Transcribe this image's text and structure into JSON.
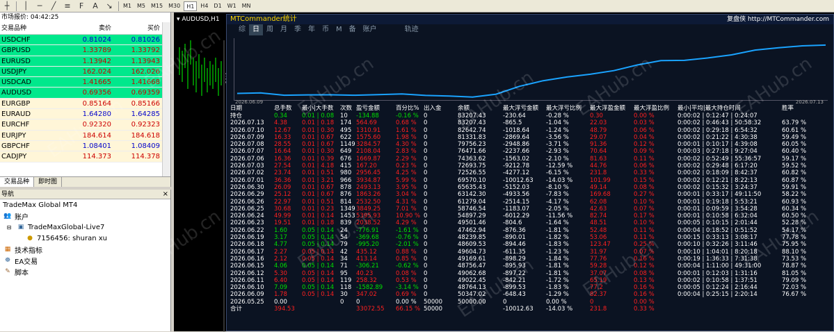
{
  "toolbar": {
    "timeframes": [
      "M1",
      "M5",
      "M15",
      "M30",
      "H1",
      "H4",
      "D1",
      "W1",
      "MN"
    ],
    "active": "H1"
  },
  "market_watch": {
    "title": "市场报价: 04:42:25",
    "col_symbol": "交易品种",
    "col_bid": "卖价",
    "col_ask": "买价",
    "rows": [
      {
        "sym": "USDCHF",
        "bid": "0.81024",
        "ask": "0.81026",
        "bg": "#00e88c",
        "color": "#0000cc"
      },
      {
        "sym": "GBPUSD",
        "bid": "1.33789",
        "ask": "1.33792",
        "bg": "#00e88c",
        "color": "#cc0000"
      },
      {
        "sym": "EURUSD",
        "bid": "1.13942",
        "ask": "1.13943",
        "bg": "#00e88c",
        "color": "#cc0000"
      },
      {
        "sym": "USDJPY",
        "bid": "162.024",
        "ask": "162.026",
        "bg": "#00e88c",
        "color": "#cc0000"
      },
      {
        "sym": "USDCAD",
        "bid": "1.41665",
        "ask": "1.41668",
        "bg": "#00e88c",
        "color": "#cc0000"
      },
      {
        "sym": "AUDUSD",
        "bid": "0.69356",
        "ask": "0.69359",
        "bg": "#00e88c",
        "color": "#cc0000"
      },
      {
        "sym": "EURGBP",
        "bid": "0.85164",
        "ask": "0.85166",
        "bg": "#fff6d8",
        "color": "#cc0000"
      },
      {
        "sym": "EURAUD",
        "bid": "1.64280",
        "ask": "1.64285",
        "bg": "#fff6d8",
        "color": "#0000cc"
      },
      {
        "sym": "EURCHF",
        "bid": "0.92320",
        "ask": "0.92323",
        "bg": "#fff6d8",
        "color": "#cc0000"
      },
      {
        "sym": "EURJPY",
        "bid": "184.614",
        "ask": "184.618",
        "bg": "#fff6d8",
        "color": "#cc0000"
      },
      {
        "sym": "GBPCHF",
        "bid": "1.08401",
        "ask": "1.08409",
        "bg": "#fff6d8",
        "color": "#0000cc"
      },
      {
        "sym": "CADJPY",
        "bid": "114.373",
        "ask": "114.378",
        "bg": "#fff6d8",
        "color": "#cc0000"
      }
    ],
    "tab_symbols": "交易品种",
    "tab_ticks": "即时图"
  },
  "navigator": {
    "title": "导航",
    "broker": "TradeMax Global MT4",
    "accounts": "账户",
    "server": "TradeMaxGlobal-Live7",
    "login": "7156456: shuran xu",
    "indicators": "技术指标",
    "ea": "EA交易",
    "scripts": "脚本"
  },
  "chart": {
    "tab": "AUDUSD,H1",
    "price": "0.05"
  },
  "panel": {
    "title": "MTCommander统计",
    "site": "复盘侠 http://MTCommander.com",
    "tabs": [
      "综",
      "日",
      "周",
      "月",
      "季",
      "年",
      "币",
      "M",
      "备",
      "账户",
      "轨迹"
    ],
    "active_tab": "日",
    "date_start": "2026.06.09",
    "date_end": "2026.07.13",
    "headers": [
      "日期",
      "总手数",
      "最小|大手数",
      "次数",
      "盈亏金额",
      "百分比%",
      "出入金",
      "余额",
      "最大浮亏金额",
      "最大浮亏比例",
      "最大浮盈金额",
      "最大浮盈比例",
      "最小|平均|最大持仓时间",
      "胜率"
    ],
    "rows": [
      [
        "持仓",
        "0.34",
        "0.01 | 0.08",
        "10",
        "-134.88",
        "-0.16 %",
        "0",
        "83207.43",
        "-230.64",
        "-0.28 %",
        "0.30",
        "0.00 %",
        "0:00:02 | 0:12:47 | 0:24:07",
        ""
      ],
      [
        "2026.07.13",
        "4.38",
        "0.01 | 0.18",
        "174",
        "564.69",
        "0.68 %",
        "0",
        "83207.43",
        "-865.5",
        "-1.04 %",
        "22.03",
        "0.03 %",
        "0:00:02 | 0:46:43 | 50:58:32",
        "63.79 %"
      ],
      [
        "2026.07.10",
        "12.67",
        "0.01 | 0.30",
        "495",
        "1310.91",
        "1.61 %",
        "0",
        "82642.74",
        "-1018.64",
        "-1.24 %",
        "48.79",
        "0.06 %",
        "0:00:02 | 0:29:18 | 6:54:32",
        "60.61 %"
      ],
      [
        "2026.07.09",
        "16.33",
        "0.01 | 0.67",
        "622",
        "1575.60",
        "1.98 %",
        "0",
        "81331.83",
        "-2869.64",
        "-3.56 %",
        "29.07",
        "0.04 %",
        "0:00:02 | 0:21:22 | 4:30:38",
        "59.49 %"
      ],
      [
        "2026.07.08",
        "28.55",
        "0.01 | 0.67",
        "1149",
        "3284.57",
        "4.30 %",
        "0",
        "79756.23",
        "-2948.86",
        "-3.71 %",
        "91.36",
        "0.12 %",
        "0:00:01 | 0:10:17 | 4:39:08",
        "60.05 %"
      ],
      [
        "2026.07.07",
        "16.64",
        "0.01 | 0.30",
        "649",
        "2108.04",
        "2.83 %",
        "0",
        "76471.66",
        "-2237.66",
        "-2.93 %",
        "70.64",
        "0.09 %",
        "0:00:03 | 0:27:18 | 9:27:04",
        "60.40 %"
      ],
      [
        "2026.07.06",
        "16.36",
        "0.01 | 0.39",
        "676",
        "1669.87",
        "2.29 %",
        "0",
        "74363.62",
        "-1563.02",
        "-2.10 %",
        "81.63",
        "0.11 %",
        "0:00:02 | 0:52:49 | 55:36:57",
        "59.17 %"
      ],
      [
        "2026.07.03",
        "27.54",
        "0.01 | 4.18",
        "415",
        "167.20",
        "0.23 %",
        "0",
        "72693.75",
        "-9212.78",
        "-12.59 %",
        "44.76",
        "0.06 %",
        "0:00:02 | 0:29:48 | 6:17:20",
        "59.52 %"
      ],
      [
        "2026.07.02",
        "23.74",
        "0.01 | 0.51",
        "980",
        "2956.45",
        "4.25 %",
        "0",
        "72526.55",
        "-4277.12",
        "-6.15 %",
        "231.8",
        "0.33 %",
        "0:00:02 | 0:18:09 | 8:42:37",
        "60.82 %"
      ],
      [
        "2026.07.01",
        "36.36",
        "0.01 | 3.21",
        "966",
        "3934.87",
        "5.99 %",
        "0",
        "69570.10",
        "-10012.63",
        "-14.03 %",
        "101.99",
        "0.15 %",
        "0:00:02 | 0:12:21 | 8:22:13",
        "60.87 %"
      ],
      [
        "2026.06.30",
        "26.09",
        "0.01 | 0.67",
        "878",
        "2493.13",
        "3.95 %",
        "0",
        "65635.43",
        "-5152.03",
        "-8.10 %",
        "49.14",
        "0.08 %",
        "0:00:02 | 0:15:32 | 3:24:37",
        "59.91 %"
      ],
      [
        "2026.06.29",
        "25.12",
        "0.01 | 0.67",
        "876",
        "1863.26",
        "3.04 %",
        "0",
        "63142.30",
        "-4933.56",
        "-7.83 %",
        "169.68",
        "0.27 %",
        "0:00:01 | 0:33:17 | 49:11:50",
        "58.22 %"
      ],
      [
        "2026.06.26",
        "22.97",
        "0.01 | 0.51",
        "814",
        "2532.50",
        "4.31 %",
        "0",
        "61279.04",
        "-2514.15",
        "-4.17 %",
        "62.08",
        "0.10 %",
        "0:00:01 | 0:19:18 | 5:53:21",
        "60.93 %"
      ],
      [
        "2026.06.25",
        "30.68",
        "0.01 | 0.23",
        "1349",
        "3849.25",
        "7.01 %",
        "0",
        "58746.54",
        "-1183.07",
        "-2.05 %",
        "42.63",
        "0.07 %",
        "0:00:01 | 0:09:59 | 3:54:28",
        "60.34 %"
      ],
      [
        "2026.06.24",
        "49.99",
        "0.01 | 0.14",
        "1453",
        "5395.93",
        "10.90 %",
        "0",
        "54897.29",
        "-6012.29",
        "-11.56 %",
        "82.74",
        "0.17 %",
        "0:00:01 | 0:10:58 | 6:32:04",
        "60.50 %"
      ],
      [
        "2026.06.23",
        "19.51",
        "0.01 | 0.18",
        "839",
        "2038.52",
        "4.29 %",
        "0",
        "49501.46",
        "-804.6",
        "-1.64 %",
        "48.51",
        "0.10 %",
        "0:00:05 | 0:10:15 | 2:01:44",
        "52.28 %"
      ],
      [
        "2026.06.22",
        "1.60",
        "0.05 | 0.14",
        "24",
        "-776.91",
        "-1.61 %",
        "0",
        "47462.94",
        "-876.36",
        "-1.81 %",
        "52.48",
        "0.11 %",
        "0:00:04 | 0:18:52 | 0:51:52",
        "54.17 %"
      ],
      [
        "2026.06.19",
        "3.17",
        "0.05 | 0.14",
        "54",
        "-369.68",
        "-0.76 %",
        "0",
        "48239.85",
        "-890.01",
        "-1.82 %",
        "53.06",
        "0.11 %",
        "0:00:15 | 0:33:13 | 3:08:17",
        "77.78 %"
      ],
      [
        "2026.06.18",
        "4.77",
        "0.05 | 0.14",
        "79",
        "-995.20",
        "-2.01 %",
        "0",
        "48609.53",
        "-894.46",
        "-1.83 %",
        "123.47",
        "0.25 %",
        "0:00:10 | 0:32:26 | 3:11:46",
        "75.95 %"
      ],
      [
        "2026.06.17",
        "2.27",
        "0.05 | 0.14",
        "42",
        "435.12",
        "0.88 %",
        "0",
        "49604.73",
        "-611.35",
        "-1.23 %",
        "31.97",
        "0.07 %",
        "0:00:10 | 1:04:01 | 8:20:18",
        "88.10 %"
      ],
      [
        "2026.06.16",
        "2.12",
        "0.05 | 0.14",
        "34",
        "413.14",
        "0.85 %",
        "0",
        "49169.61",
        "-898.29",
        "-1.84 %",
        "77.76",
        "0.16 %",
        "0:00:19 | 1:36:33 | 7:31:38",
        "73.53 %"
      ],
      [
        "2026.06.15",
        "4.06",
        "0.05 | 0.14",
        "71",
        "-306.21",
        "-0.62 %",
        "0",
        "48756.47",
        "-895.93",
        "-1.81 %",
        "59.28",
        "0.12 %",
        "0:00:04 | 1:11:00 | 49:31:00",
        "78.87 %"
      ],
      [
        "2026.06.12",
        "5.30",
        "0.05 | 0.14",
        "95",
        "40.23",
        "0.08 %",
        "0",
        "49062.68",
        "-897.22",
        "-1.81 %",
        "37.07",
        "0.08 %",
        "0:00:01 | 0:12:03 | 1:31:16",
        "81.05 %"
      ],
      [
        "2026.06.11",
        "6.40",
        "0.05 | 0.14",
        "119",
        "258.32",
        "0.53 %",
        "0",
        "49022.45",
        "-842.21",
        "-1.72 %",
        "65.19",
        "0.13 %",
        "0:00:02 | 0:10:58 | 1:37:51",
        "79.09 %"
      ],
      [
        "2026.06.10",
        "7.09",
        "0.05 | 0.14",
        "118",
        "-1582.89",
        "-3.14 %",
        "0",
        "48764.13",
        "-899.53",
        "-1.83 %",
        "77.2",
        "0.16 %",
        "0:00:05 | 0:12:24 | 2:16:44",
        "72.03 %"
      ],
      [
        "2026.06.09",
        "1.78",
        "0.05 | 0.14",
        "30",
        "347.02",
        "0.69 %",
        "0",
        "50347.02",
        "-648.43",
        "-1.29 %",
        "82.37",
        "0.16 %",
        "0:00:04 | 0:25:15 | 2:20:14",
        "76.67 %"
      ],
      [
        "2026.05.25",
        "0.00",
        "",
        "0",
        "0",
        "0.00 %",
        "50000",
        "50000.00",
        "0",
        "0.00 %",
        "0",
        "0.00 %",
        "",
        ""
      ]
    ],
    "total": [
      "合计",
      "394.53",
      "",
      "",
      "33072.55",
      "66.15 %",
      "50000",
      "",
      "-10012.63",
      "-14.03 %",
      "231.8",
      "0.33 %",
      "",
      ""
    ]
  },
  "watermark": "EAHub.cn"
}
